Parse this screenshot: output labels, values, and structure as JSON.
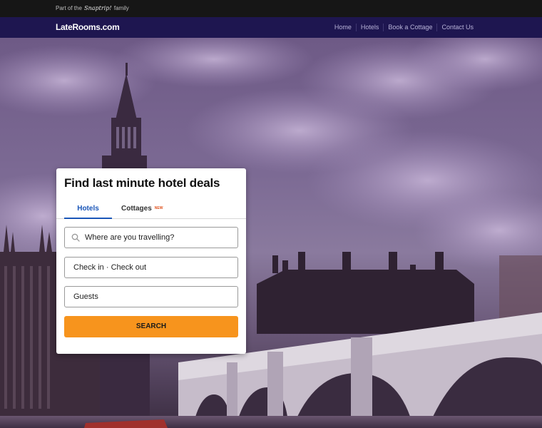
{
  "topstrip": {
    "prefix": "Part of the",
    "brand": "Snaptrip!",
    "suffix": "family"
  },
  "header": {
    "logo": "LateRooms.com",
    "nav": [
      "Home",
      "Hotels",
      "Book a Cottage",
      "Contact Us"
    ]
  },
  "search_card": {
    "title": "Find last minute hotel deals",
    "tabs": [
      {
        "label": "Hotels",
        "active": true
      },
      {
        "label": "Cottages",
        "badge": "NEW"
      }
    ],
    "destination_placeholder": "Where are you travelling?",
    "dates_label": "Check in · Check out",
    "guests_label": "Guests",
    "search_button": "SEARCH"
  },
  "colors": {
    "nav_bg": "#1e1650",
    "accent_blue": "#1a56b8",
    "search_orange": "#f7941d"
  },
  "icons": {
    "search": "magnifier-icon"
  }
}
